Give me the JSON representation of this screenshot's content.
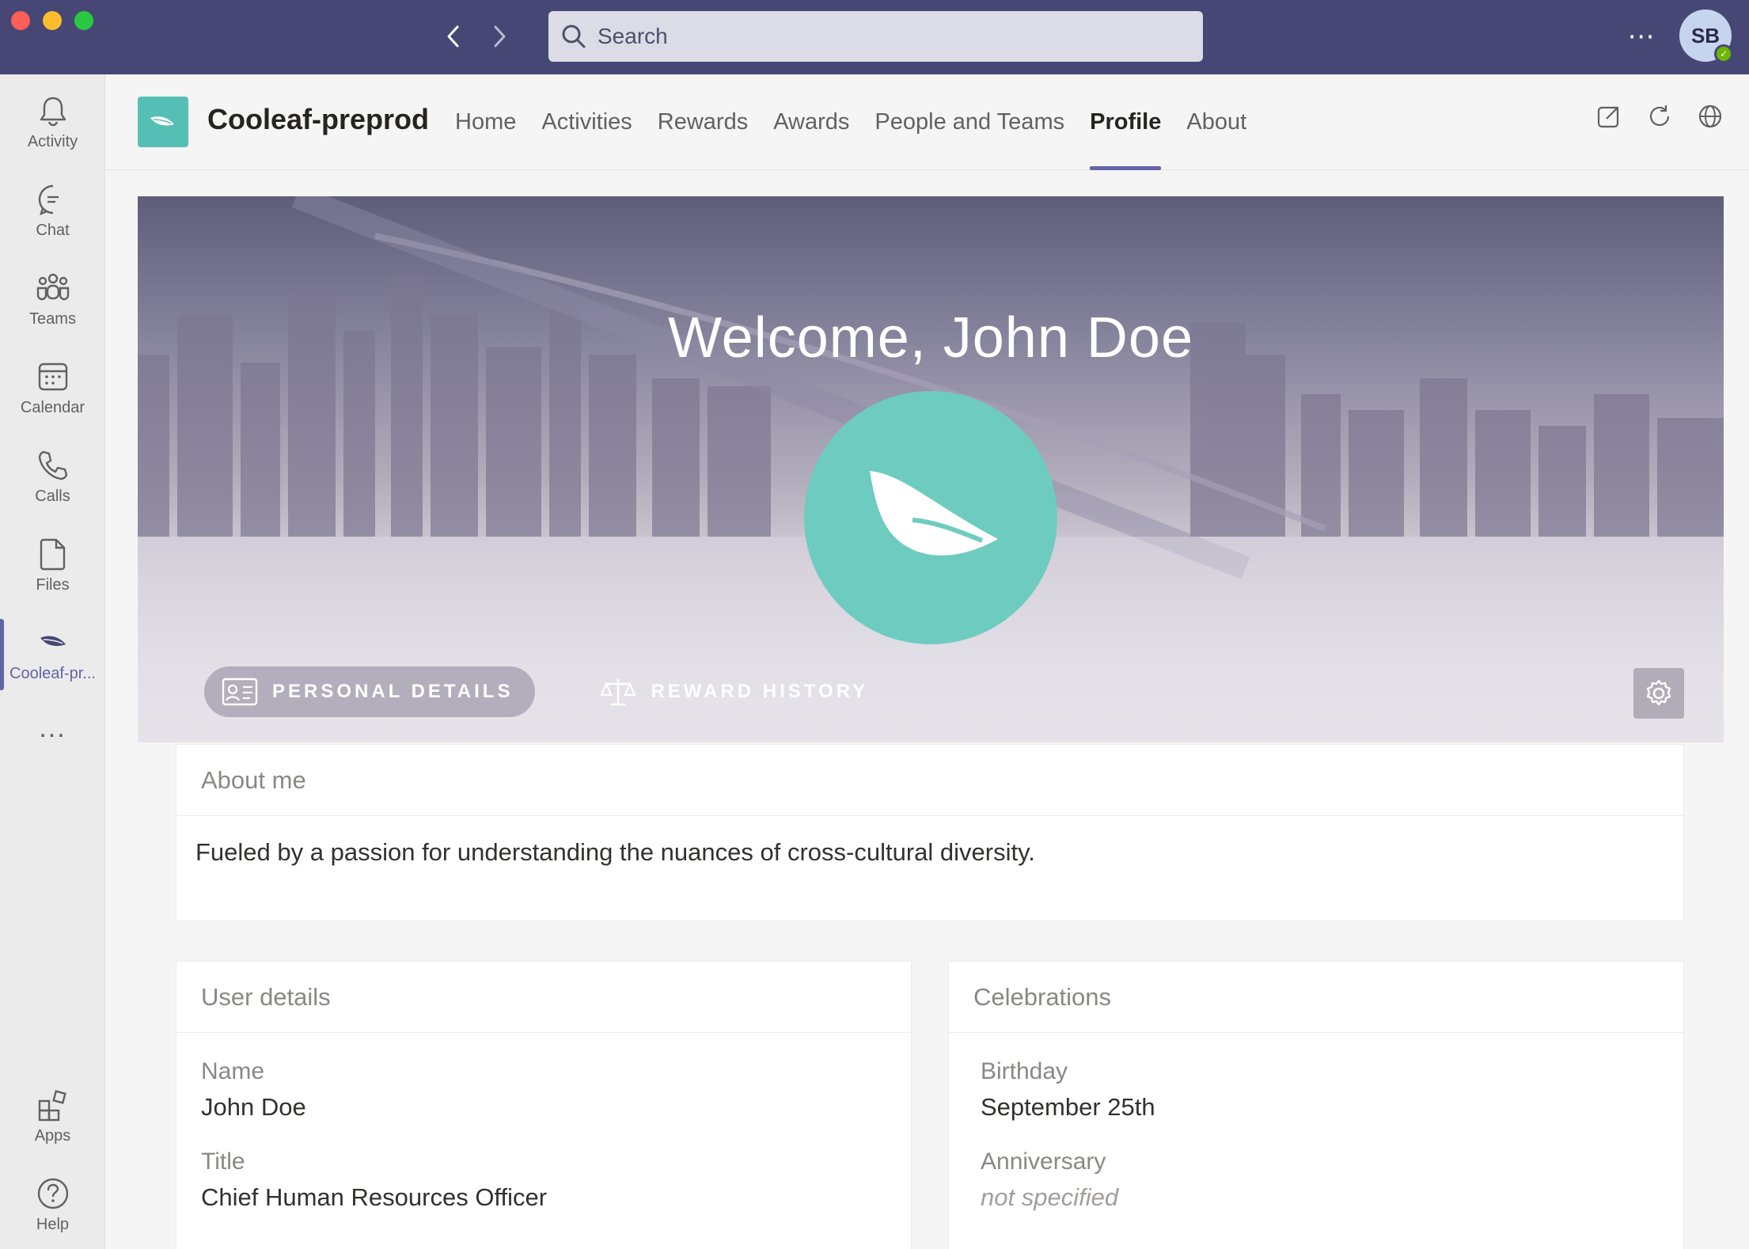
{
  "search": {
    "placeholder": "Search"
  },
  "me": {
    "initials": "SB"
  },
  "rail": {
    "items": [
      {
        "label": "Activity"
      },
      {
        "label": "Chat"
      },
      {
        "label": "Teams"
      },
      {
        "label": "Calendar"
      },
      {
        "label": "Calls"
      },
      {
        "label": "Files"
      },
      {
        "label": "Cooleaf-pr..."
      }
    ],
    "more": "...",
    "apps": "Apps",
    "help": "Help"
  },
  "app": {
    "name": "Cooleaf-preprod",
    "tabs": [
      "Home",
      "Activities",
      "Rewards",
      "Awards",
      "People and Teams",
      "Profile",
      "About"
    ],
    "active_tab": "Profile"
  },
  "hero": {
    "welcome": "Welcome, John Doe",
    "tabs": [
      "PERSONAL DETAILS",
      "REWARD HISTORY"
    ]
  },
  "about": {
    "title": "About me",
    "text": "Fueled by a passion for understanding the nuances of cross-cultural diversity."
  },
  "user_details": {
    "title": "User details",
    "name_label": "Name",
    "name_value": "John Doe",
    "title_label": "Title",
    "title_value": "Chief Human Resources Officer"
  },
  "celebrations": {
    "title": "Celebrations",
    "birthday_label": "Birthday",
    "birthday_value": "September 25th",
    "anniversary_label": "Anniversary",
    "anniversary_value": "not specified"
  },
  "colors": {
    "titlebar": "#464775",
    "accent": "#6264a7",
    "teal": "#56bfb5"
  }
}
